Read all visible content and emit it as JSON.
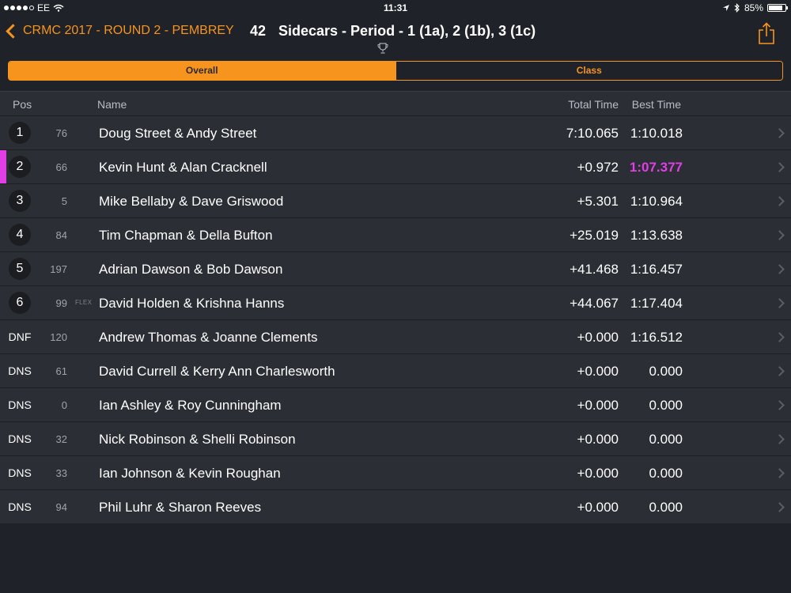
{
  "status_bar": {
    "carrier": "EE",
    "time": "11:31",
    "battery": "85%",
    "battery_level": 0.85
  },
  "nav": {
    "back_label": "CRMC 2017 - ROUND 2 - PEMBREY",
    "session_number": "42",
    "session_title": "Sidecars - Period - 1 (1a), 2 (1b), 3 (1c)"
  },
  "tabs": [
    {
      "label": "Overall",
      "active": true
    },
    {
      "label": "Class",
      "active": false
    }
  ],
  "table": {
    "headers": {
      "pos": "Pos",
      "name": "Name",
      "total_time": "Total Time",
      "best_time": "Best Time"
    },
    "rows": [
      {
        "pos": "1",
        "car": "76",
        "tag": "",
        "name": "Doug Street & Andy Street",
        "total": "7:10.065",
        "best": "1:10.018",
        "best_highlight": false,
        "marker": false
      },
      {
        "pos": "2",
        "car": "66",
        "tag": "",
        "name": "Kevin Hunt & Alan Cracknell",
        "total": "+0.972",
        "best": "1:07.377",
        "best_highlight": true,
        "marker": true
      },
      {
        "pos": "3",
        "car": "5",
        "tag": "",
        "name": "Mike Bellaby  & Dave Griswood",
        "total": "+5.301",
        "best": "1:10.964",
        "best_highlight": false,
        "marker": false
      },
      {
        "pos": "4",
        "car": "84",
        "tag": "",
        "name": "Tim Chapman & Della Bufton",
        "total": "+25.019",
        "best": "1:13.638",
        "best_highlight": false,
        "marker": false
      },
      {
        "pos": "5",
        "car": "197",
        "tag": "",
        "name": "Adrian Dawson & Bob Dawson",
        "total": "+41.468",
        "best": "1:16.457",
        "best_highlight": false,
        "marker": false
      },
      {
        "pos": "6",
        "car": "99",
        "tag": "FLEX",
        "name": "David Holden & Krishna Hanns",
        "total": "+44.067",
        "best": "1:17.404",
        "best_highlight": false,
        "marker": false
      },
      {
        "pos": "DNF",
        "car": "120",
        "tag": "",
        "name": "Andrew Thomas & Joanne Clements",
        "total": "+0.000",
        "best": "1:16.512",
        "best_highlight": false,
        "marker": false
      },
      {
        "pos": "DNS",
        "car": "61",
        "tag": "",
        "name": "David Currell & Kerry Ann Charlesworth",
        "total": "+0.000",
        "best": "0.000",
        "best_highlight": false,
        "marker": false
      },
      {
        "pos": "DNS",
        "car": "0",
        "tag": "",
        "name": "Ian Ashley & Roy Cunningham",
        "total": "+0.000",
        "best": "0.000",
        "best_highlight": false,
        "marker": false
      },
      {
        "pos": "DNS",
        "car": "32",
        "tag": "",
        "name": "Nick Robinson  & Shelli Robinson",
        "total": "+0.000",
        "best": "0.000",
        "best_highlight": false,
        "marker": false
      },
      {
        "pos": "DNS",
        "car": "33",
        "tag": "",
        "name": "Ian Johnson & Kevin Roughan",
        "total": "+0.000",
        "best": "0.000",
        "best_highlight": false,
        "marker": false
      },
      {
        "pos": "DNS",
        "car": "94",
        "tag": "",
        "name": "Phil Luhr & Sharon Reeves",
        "total": "+0.000",
        "best": "0.000",
        "best_highlight": false,
        "marker": false
      }
    ]
  },
  "colors": {
    "accent": "#f7941d",
    "highlight": "#e23ee6",
    "background": "#1f2228",
    "row_background": "#2b2e35"
  },
  "icons": {
    "back": "chevron-left-icon",
    "trophy": "trophy-icon",
    "share": "share-icon",
    "row_disclosure": "chevron-right-icon"
  }
}
